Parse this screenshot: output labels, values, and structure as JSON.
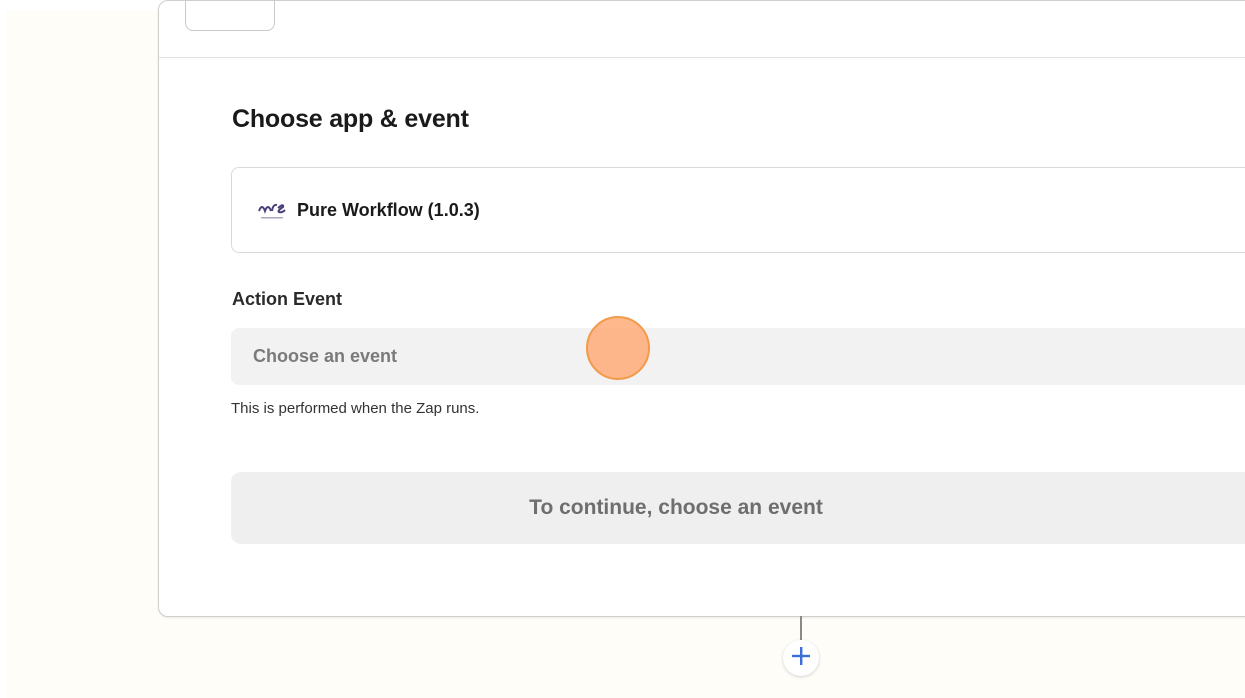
{
  "editor": {
    "section_title": "Choose app & event",
    "app_selector": {
      "app_name": "Pure Workflow (1.0.3)",
      "logo_icon": "pure-workflow-logo-icon"
    },
    "action_event": {
      "label": "Action Event",
      "placeholder": "Choose an event",
      "help_text": "This is performed when the Zap runs."
    },
    "continue_button": {
      "label": "To continue, choose an event"
    }
  },
  "add_step": {
    "icon": "plus-icon"
  },
  "colors": {
    "accent": "#3b6ddb",
    "page_background": "#fffdf7",
    "cursor_highlight": "#f39a4a"
  }
}
